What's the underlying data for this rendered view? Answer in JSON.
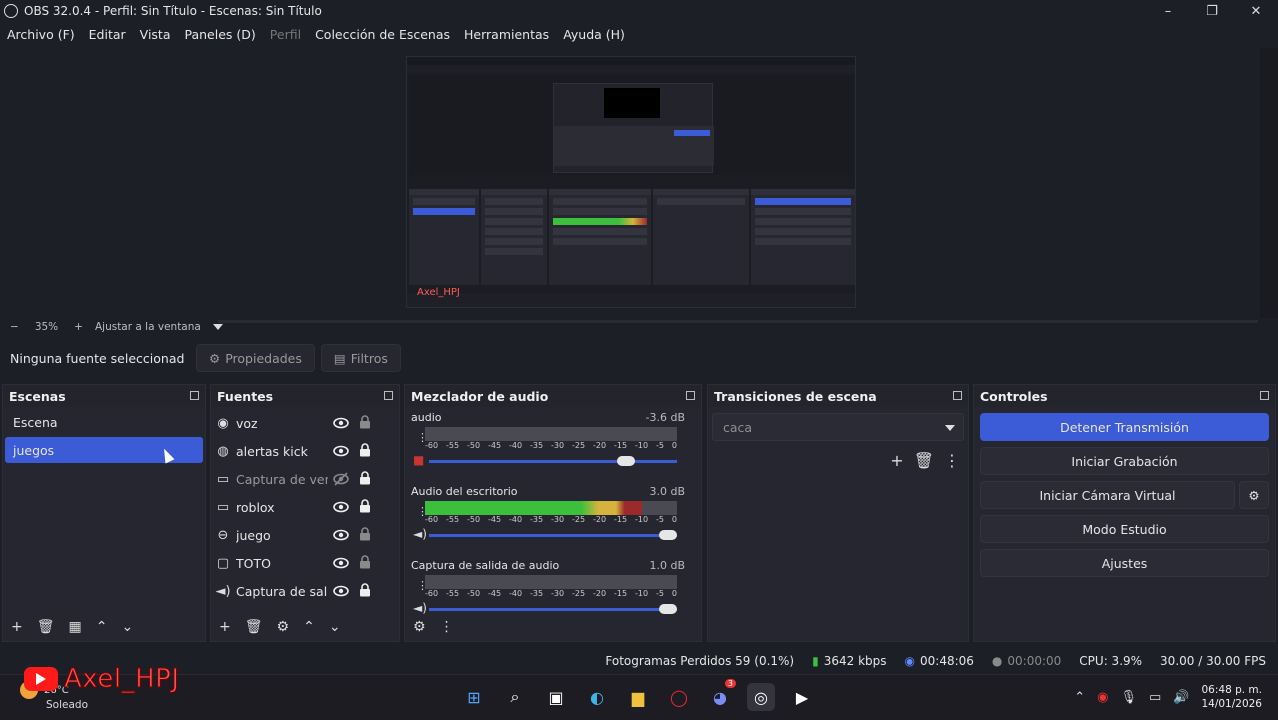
{
  "window": {
    "title": "OBS 32.0.4 - Perfil: Sin Título - Escenas: Sin Título",
    "buttons": [
      "–",
      "❐",
      "✕"
    ]
  },
  "menu": [
    {
      "label": "Archivo (F)",
      "disabled": false
    },
    {
      "label": "Editar",
      "disabled": false
    },
    {
      "label": "Vista",
      "disabled": false
    },
    {
      "label": "Paneles (D)",
      "disabled": false
    },
    {
      "label": "Perfil",
      "disabled": true
    },
    {
      "label": "Colección de Escenas",
      "disabled": false
    },
    {
      "label": "Herramientas",
      "disabled": false
    },
    {
      "label": "Ayuda (H)",
      "disabled": false
    }
  ],
  "preview": {
    "zoom_minus": "−",
    "zoom_value": "35%",
    "zoom_plus": "+",
    "zoom_mode": "Ajustar a la ventana",
    "canvas_watermark": "Axel_HPJ"
  },
  "source_toolbar": {
    "no_source": "Ninguna fuente seleccionad",
    "properties": "Propiedades",
    "filters": "Filtros"
  },
  "scenes": {
    "title": "Escenas",
    "items": [
      "Escena",
      "juegos"
    ],
    "selected_index": 1
  },
  "sources": {
    "title": "Fuentes",
    "items": [
      {
        "label": "voz",
        "icon": "audio-input-icon",
        "visible": true,
        "locked": false,
        "dim": false
      },
      {
        "label": "alertas kick",
        "icon": "globe-icon",
        "visible": true,
        "locked": true,
        "dim": false
      },
      {
        "label": "Captura de ventana",
        "icon": "window-capture-icon",
        "visible": false,
        "locked": true,
        "dim": true
      },
      {
        "label": "roblox",
        "icon": "window-capture-icon",
        "visible": true,
        "locked": true,
        "dim": false
      },
      {
        "label": "juego",
        "icon": "gamepad-icon",
        "visible": true,
        "locked": false,
        "dim": false
      },
      {
        "label": "TOTO",
        "icon": "monitor-icon",
        "visible": true,
        "locked": false,
        "dim": false
      },
      {
        "label": "Captura de salida de audio",
        "icon": "speaker-icon",
        "visible": true,
        "locked": true,
        "dim": false
      }
    ]
  },
  "mixer": {
    "title": "Mezclador de audio",
    "ticks": [
      "-60",
      "-55",
      "-50",
      "-45",
      "-40",
      "-35",
      "-30",
      "-25",
      "-20",
      "-15",
      "-10",
      "-5",
      "0"
    ],
    "channels": [
      {
        "name": "audio",
        "db": "-3.6 dB",
        "level": 0.0,
        "volume": 0.83,
        "muted": true
      },
      {
        "name": "Audio del escritorio",
        "db": "3.0 dB",
        "level": 0.86,
        "volume": 1.0,
        "muted": false
      },
      {
        "name": "Captura de salida de audio",
        "db": "1.0 dB",
        "level": 0.0,
        "volume": 1.0,
        "muted": false
      }
    ]
  },
  "transitions": {
    "title": "Transiciones de escena",
    "selected": "caca"
  },
  "controls": {
    "title": "Controles",
    "buttons": [
      "Detener Transmisión",
      "Iniciar Grabación",
      "Iniciar Cámara Virtual",
      "Modo Estudio",
      "Ajustes"
    ]
  },
  "status": {
    "dropped_frames": "Fotogramas Perdidos 59 (0.1%)",
    "bitrate": "3642 kbps",
    "stream_time": "00:48:06",
    "record_time": "00:00:00",
    "cpu": "CPU: 3.9%",
    "fps": "30.00 / 30.00 FPS"
  },
  "watermark": {
    "text": "Axel_HPJ"
  },
  "taskbar": {
    "weather_temp": "26°C",
    "weather_cond": "Soleado",
    "time": "06:48 p. m.",
    "date": "14/01/2026",
    "discord_badge": "3"
  },
  "colors": {
    "accent": "#3c5bd6",
    "meter_green": "#3cbf3c",
    "meter_yellow": "#d6b33c",
    "meter_red": "#9c2a2a"
  }
}
